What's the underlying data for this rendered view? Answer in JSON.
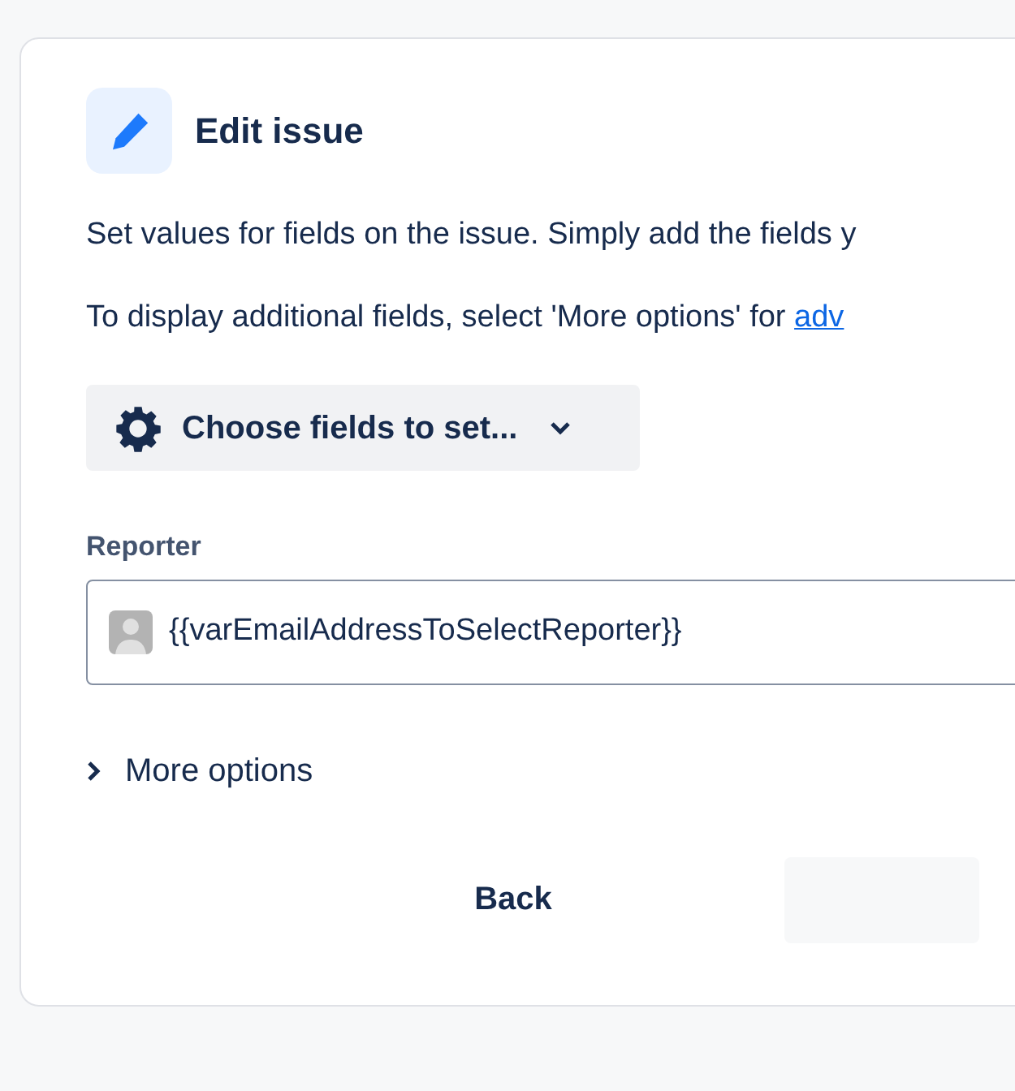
{
  "header": {
    "title": "Edit issue"
  },
  "description": [
    "Set values for fields on the issue. Simply add the fields y"
  ],
  "hint": {
    "text": "To display additional fields, select 'More options' for ",
    "link": "adv"
  },
  "choose_button": {
    "label": "Choose fields to set..."
  },
  "reporter": {
    "label": "Reporter",
    "value": "{{varEmailAddressToSelectReporter}}"
  },
  "more_options": {
    "label": "More options",
    "expanded": false
  },
  "footer": {
    "back": "Back"
  }
}
